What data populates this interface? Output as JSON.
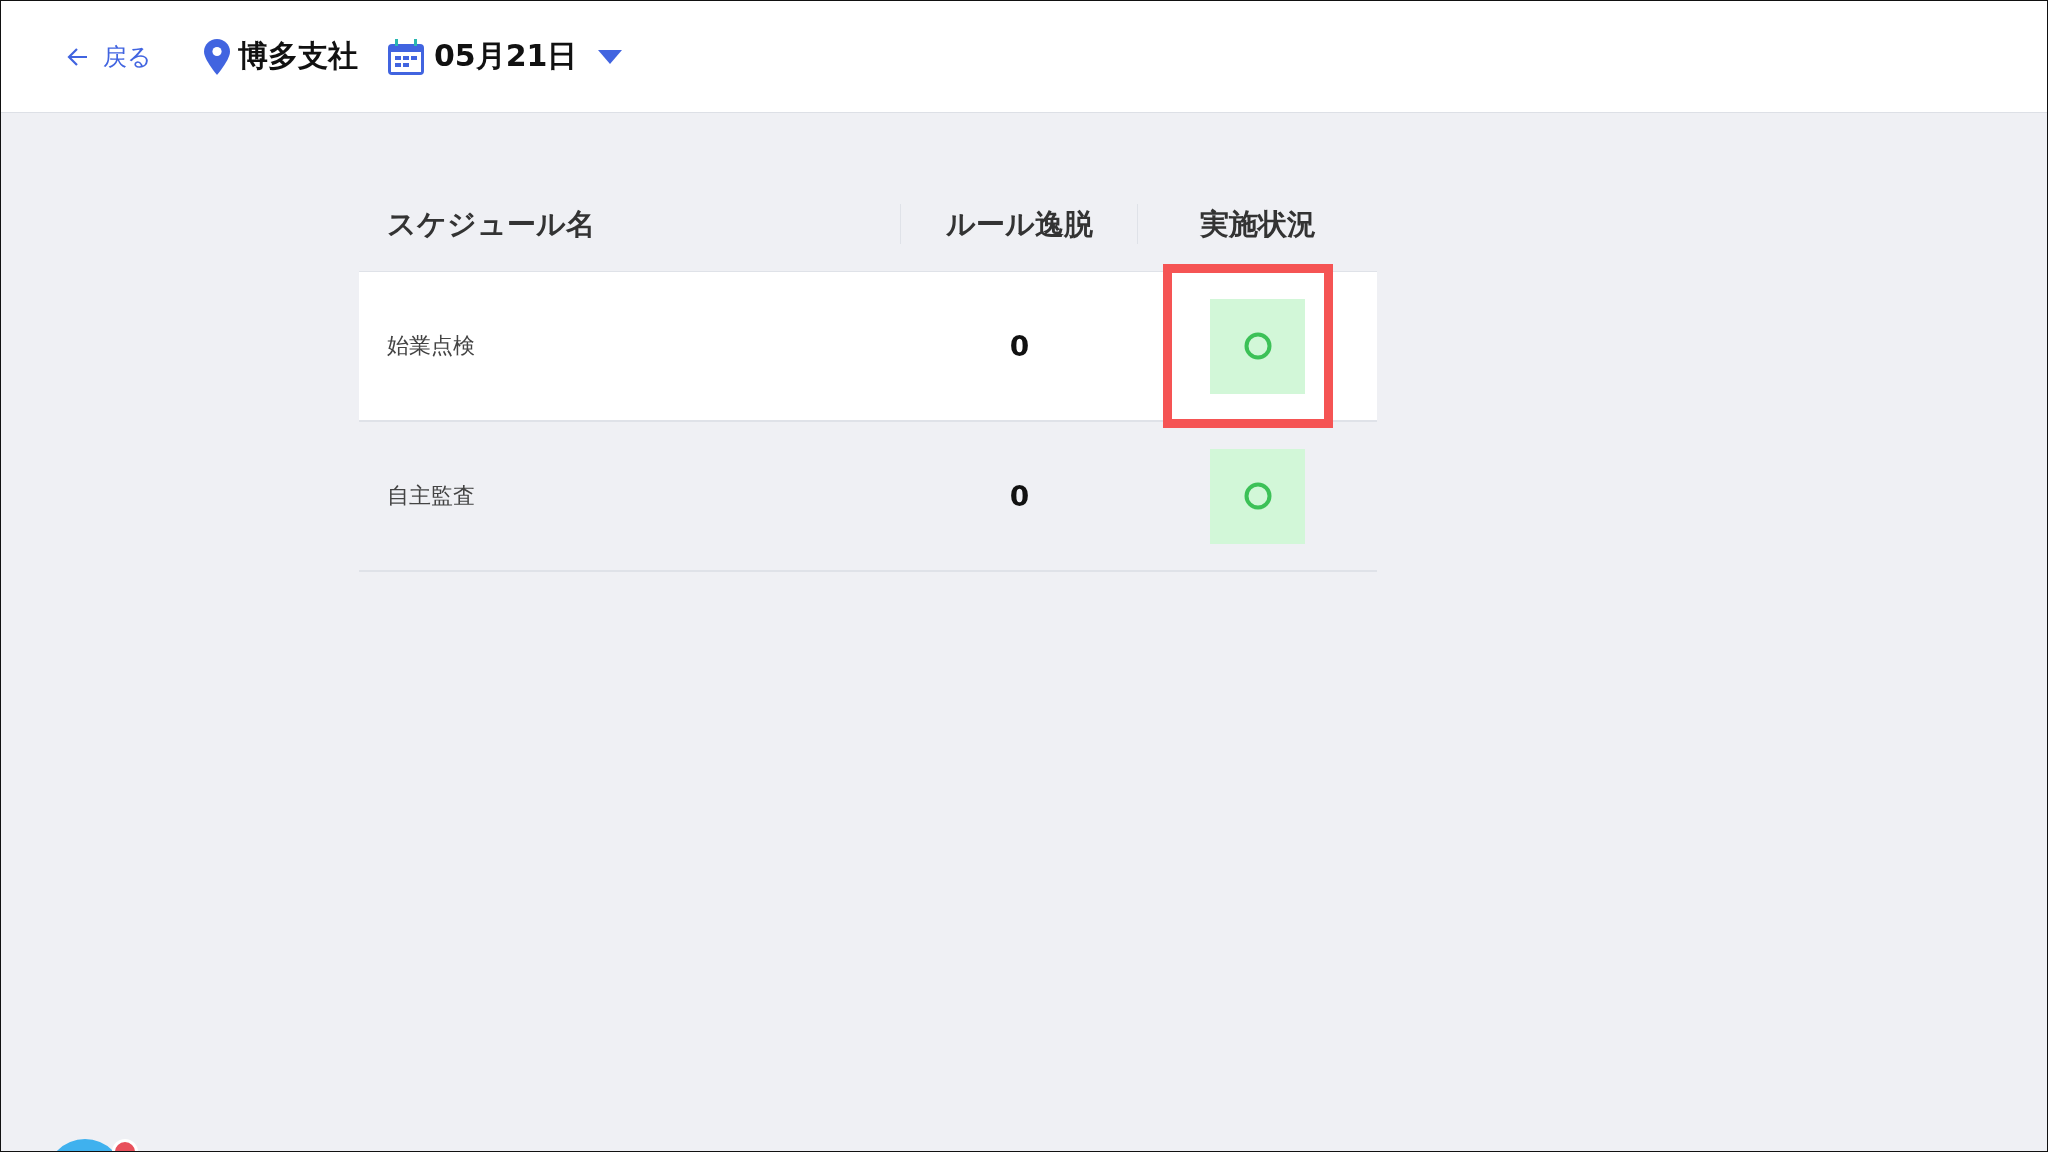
{
  "header": {
    "back": {
      "label": "戻る"
    },
    "location": "博多支社",
    "date": "05月21日"
  },
  "table": {
    "columns": [
      "スケジュール名",
      "ルール逸脱",
      "実施状況"
    ],
    "rows": [
      {
        "name": "始業点検",
        "deviations": "0",
        "completed": true,
        "highlighted": true,
        "annotated": true
      },
      {
        "name": "自主監査",
        "deviations": "0",
        "completed": true,
        "highlighted": false,
        "annotated": false
      }
    ]
  },
  "chat_launcher": {
    "has_badge": true
  }
}
